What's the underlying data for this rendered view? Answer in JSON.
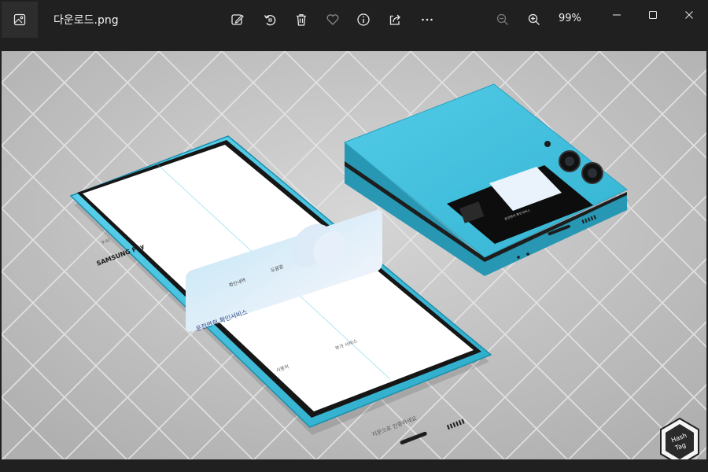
{
  "window": {
    "filename": "다운로드.png",
    "zoom_level": "99%"
  },
  "toolbar": {
    "icons": [
      "edit-image-icon",
      "rotate-icon",
      "delete-icon",
      "favorite-heart-icon",
      "info-icon",
      "share-icon",
      "more-options-icon"
    ],
    "zoom_icons": [
      "zoom-out-icon",
      "zoom-in-icon"
    ]
  },
  "window_controls": [
    "minimize-icon",
    "maximize-icon",
    "close-icon"
  ],
  "image": {
    "watermark_line1": "Hash",
    "watermark_line2": "Tag",
    "phone_screen": {
      "brand": "SAMSUNG Pay",
      "card_title": "운전면허 확인서비스",
      "menu_left": "확인내역",
      "menu_right": "도움말",
      "card_footer_left": "사용처",
      "card_footer_right": "부가 서비스",
      "bottom_prompt": "지문으로 인증하세요",
      "status_time": "9:42"
    },
    "cover_screen_text": "운전면허 확인서비스"
  },
  "colors": {
    "titlebar_bg": "#202020",
    "phone_body": "#3fc1de",
    "floor": "#c4c4c4"
  }
}
